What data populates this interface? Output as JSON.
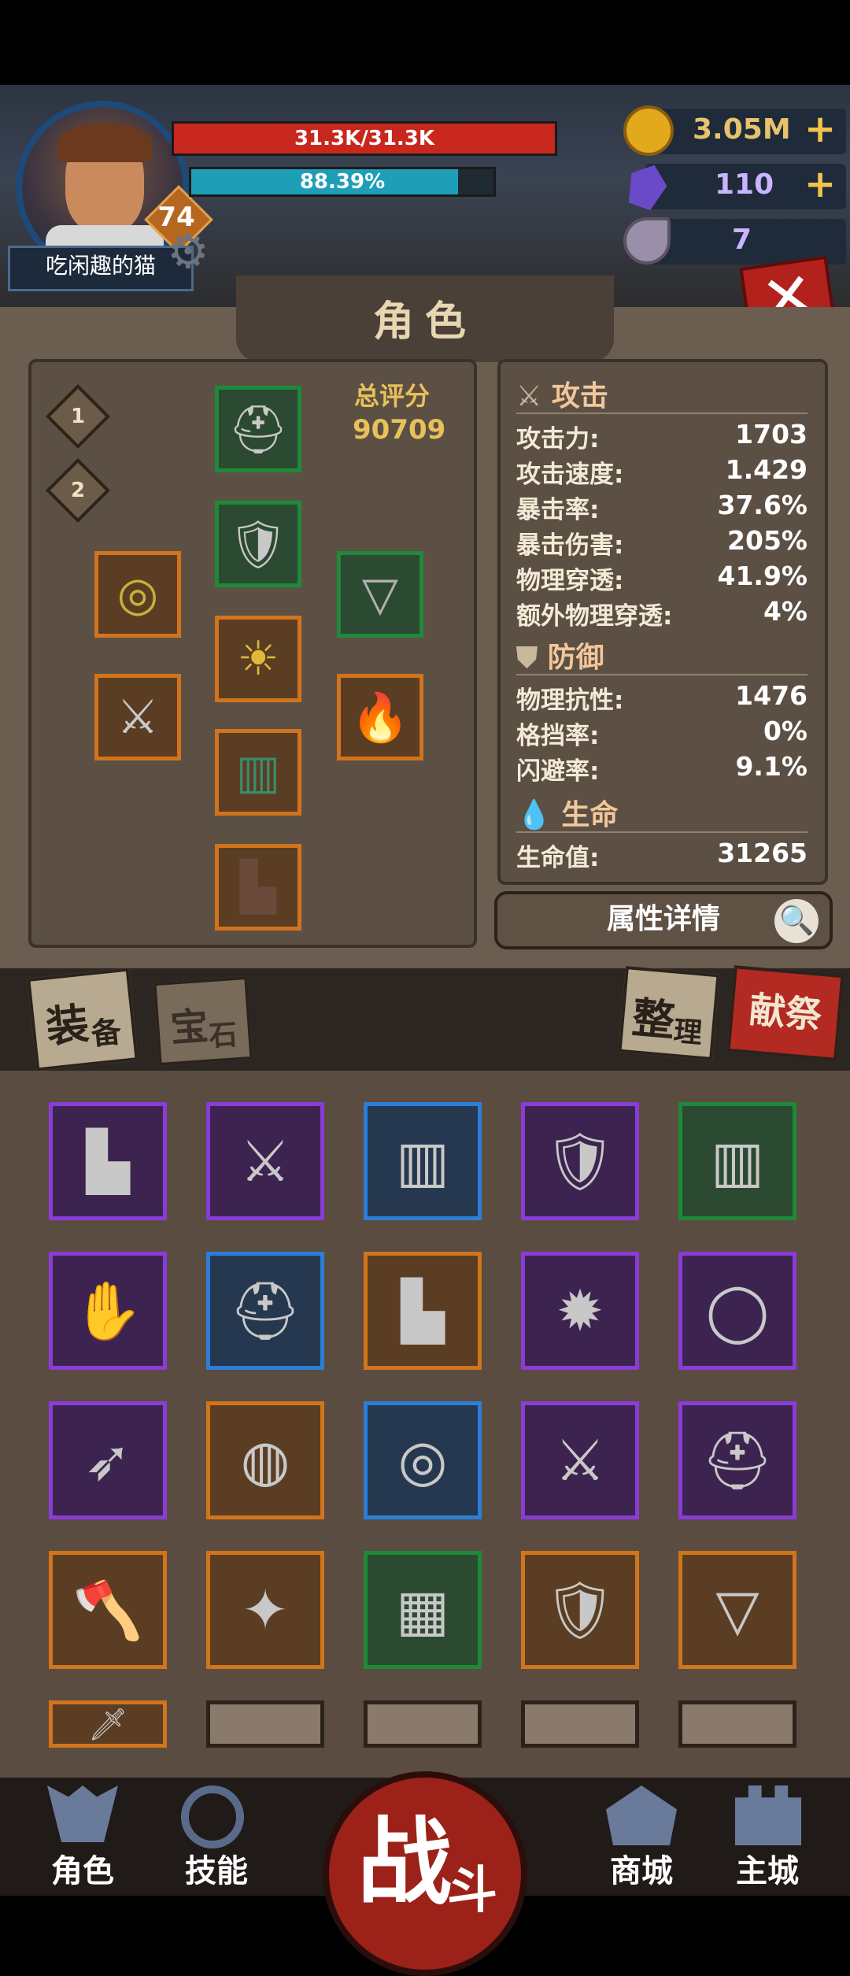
{
  "player": {
    "name": "吃闲趣的猫",
    "level": "74",
    "hp_text": "31.3K/31.3K",
    "exp_text": "88.39%",
    "exp_fraction": 0.8839
  },
  "resources": {
    "gold": "3.05M",
    "crystals": "110",
    "horns": "7"
  },
  "panel": {
    "title": "角色",
    "loadout_1": "1",
    "loadout_2": "2",
    "score_label": "总评分",
    "score_value": "90709"
  },
  "stats": {
    "attack_head": "攻击",
    "attack": [
      {
        "label": "攻击力:",
        "value": "1703"
      },
      {
        "label": "攻击速度:",
        "value": "1.429"
      },
      {
        "label": "暴击率:",
        "value": "37.6%"
      },
      {
        "label": "暴击伤害:",
        "value": "205%"
      },
      {
        "label": "物理穿透:",
        "value": "41.9%"
      },
      {
        "label": "额外物理穿透:",
        "value": "4%"
      }
    ],
    "defense_head": "防御",
    "defense": [
      {
        "label": "物理抗性:",
        "value": "1476"
      },
      {
        "label": "格挡率:",
        "value": "0%"
      },
      {
        "label": "闪避率:",
        "value": "9.1%"
      }
    ],
    "life_head": "生命",
    "life": [
      {
        "label": "生命值:",
        "value": "31265"
      }
    ],
    "detail_button": "属性详情"
  },
  "tabs": {
    "equip_main": "装",
    "equip_sub": "备",
    "gem_main": "宝",
    "gem_sub": "石",
    "sort_main": "整",
    "sort_sub": "理",
    "sacrifice": "献祭"
  },
  "nav": {
    "character": "角色",
    "skills": "技能",
    "battle_main": "战",
    "battle_sub": "斗",
    "shop": "商城",
    "main_city": "主城"
  },
  "colors": {
    "hp": "#c8271d",
    "exp": "#1f9fb7",
    "legendary": "#d2741c",
    "epic": "#8a3bd8",
    "rare": "#2b7fd8",
    "uncommon": "#1d8a3a"
  },
  "equipped_icons": [
    "helmet-icon",
    "chest-armor-icon",
    "necklace-icon",
    "ring-icon",
    "belt-icon",
    "torch-icon",
    "drill-weapon-icon",
    "pants-icon",
    "boots-icon"
  ],
  "inventory_icons": [
    "boots-icon",
    "scimitar-icon",
    "pants-icon",
    "chest-armor-icon",
    "pants-icon",
    "gloves-icon",
    "hood-icon",
    "boots-icon",
    "spiked-mace-icon",
    "belt-icon",
    "spear-icon",
    "claw-ring-icon",
    "gold-ring-icon",
    "scimitar-icon",
    "knight-helmet-icon",
    "axe-icon",
    "staff-icon",
    "skirt-icon",
    "shoulder-armor-icon",
    "fang-necklace-icon",
    "sword-icon",
    "empty-slot",
    "empty-slot",
    "empty-slot",
    "empty-slot"
  ]
}
